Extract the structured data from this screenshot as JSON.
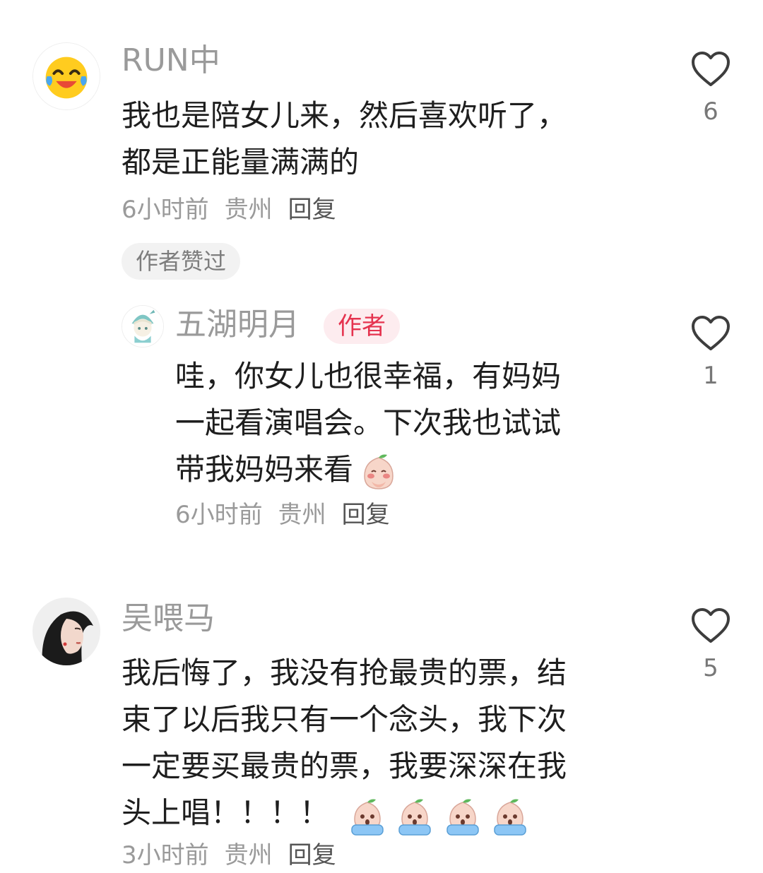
{
  "comments": [
    {
      "username": "RUN中",
      "text_lines": [
        "我也是陪女儿来，然后喜欢听了，",
        "都是正能量满满的"
      ],
      "time": "6小时前",
      "location": "贵州",
      "reply_label": "回复",
      "liked_by_author": "作者赞过",
      "likes": "6",
      "avatar_icon": "laughing-emoji-icon"
    },
    {
      "username": "五湖明月",
      "author_tag": "作者",
      "text_lines": [
        "哇，你女儿也很幸福，有妈妈",
        "一起看演唱会。下次我也试试",
        "带我妈妈来看"
      ],
      "time": "6小时前",
      "location": "贵州",
      "reply_label": "回复",
      "likes": "1",
      "avatar_icon": "anime-character-avatar",
      "sticker_icon": "shy-peach-sticker-icon"
    },
    {
      "username": "吴喂马",
      "text_lines": [
        "我后悔了，我没有抢最贵的票，结",
        "束了以后我只有一个念头，我下次",
        "一定要买最贵的票，我要深深在我",
        "头上唱！！！！"
      ],
      "time": "3小时前",
      "location": "贵州",
      "reply_label": "回复",
      "likes": "5",
      "avatar_icon": "woman-photo-avatar",
      "sticker_icon": "crying-peach-sticker-icon"
    }
  ],
  "colors": {
    "username": "#9a9a9a",
    "author_tag_text": "#e5334f",
    "author_tag_bg": "#fdecef",
    "meta": "#9a9a9a",
    "reply": "#555555"
  }
}
